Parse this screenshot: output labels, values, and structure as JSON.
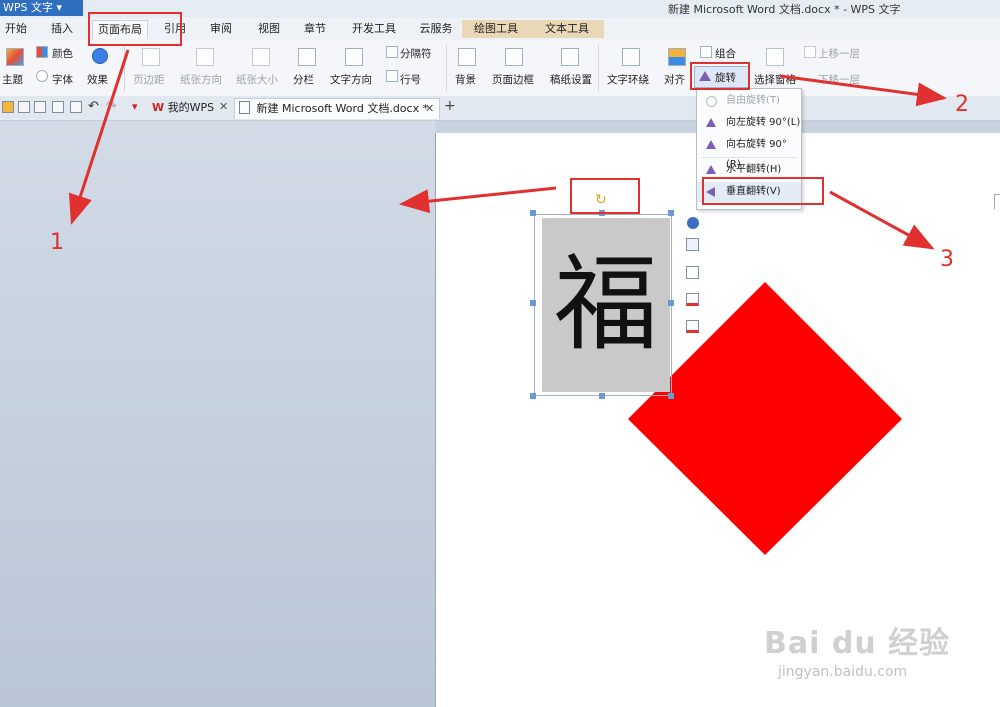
{
  "app": {
    "name": "WPS 文字",
    "window_title": "新建 Microsoft Word 文档.docx * - WPS 文字"
  },
  "menu_tabs": [
    "开始",
    "插入",
    "页面布局",
    "引用",
    "审阅",
    "视图",
    "章节",
    "开发工具",
    "云服务",
    "绘图工具",
    "文本工具"
  ],
  "active_tab": "页面布局",
  "ribbon": {
    "theme": "主题",
    "colors": "颜色",
    "fonts": "字体",
    "effects": "效果",
    "margins": "页边距",
    "orientation": "纸张方向",
    "size": "纸张大小",
    "columns": "分栏",
    "text_direction": "文字方向",
    "breaks": "分隔符",
    "line_numbers": "行号",
    "background": "背景",
    "page_border": "页面边框",
    "draft_settings": "稿纸设置",
    "text_wrap": "文字环绕",
    "align": "对齐",
    "rotate": "旋转",
    "group": "组合",
    "selection_pane": "选择窗格",
    "bring_forward": "上移一层",
    "send_backward": "下移一层"
  },
  "doc_tabs": {
    "my_wps": "我的WPS",
    "document": "新建 Microsoft Word 文档.docx *",
    "add": "+"
  },
  "rotate_menu": {
    "items": [
      "自由旋转(T)",
      "向左旋转 90°(L)",
      "向右旋转 90°(R)",
      "水平翻转(H)",
      "垂直翻转(V)"
    ],
    "highlighted": "垂直翻转(V)"
  },
  "canvas": {
    "fu_character": "福",
    "shape_color": "#ff0000"
  },
  "annotations": {
    "labels": [
      "1",
      "2",
      "3"
    ],
    "color": "#e03030"
  },
  "watermark": {
    "brand": "Bai du 经验",
    "url": "jingyan.baidu.com"
  }
}
